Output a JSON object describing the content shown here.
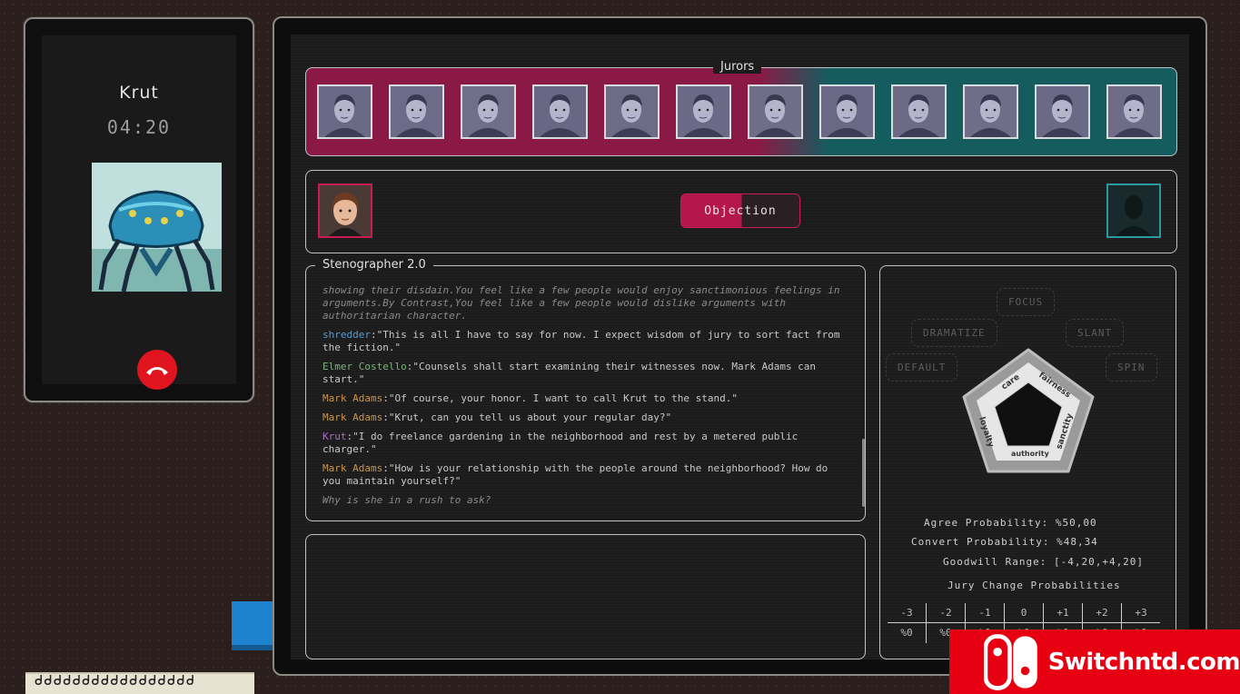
{
  "phone": {
    "caller_name": "Krut",
    "timer": "04:20",
    "hangup_icon": "phone-hangup-icon"
  },
  "jurors": {
    "label": "Jurors",
    "count": 12
  },
  "objection": {
    "label": "Objection",
    "progress": 0.51
  },
  "stenographer": {
    "title": "Stenographer 2.0",
    "lines": [
      {
        "speaker": "",
        "text": "showing their disdain.You feel like a few people would enjoy sanctimonious feelings in arguments.By Contrast,You feel like a few people would dislike arguments with authoritarian character.",
        "style": "italic"
      },
      {
        "speaker": "shredder",
        "text": ":\"This is all I have to say for now. I expect wisdom of jury to sort fact from the fiction.\"",
        "style": "blue"
      },
      {
        "speaker": "Elmer Costello",
        "text": ":\"Counsels shall start examining their witnesses now. Mark Adams can start.\"",
        "style": "green"
      },
      {
        "speaker": "Mark Adams",
        "text": ":\"Of course, your honor. I want to call Krut to the stand.\"",
        "style": "orange"
      },
      {
        "speaker": "Mark Adams",
        "text": ":\"Krut, can you tell us about your regular day?\"",
        "style": "orange"
      },
      {
        "speaker": "Krut",
        "text": ":\"I do freelance gardening in the neighborhood and rest by a metered public charger.\"",
        "style": "purple"
      },
      {
        "speaker": "Mark Adams",
        "text": ":\"How is your relationship with the people around the neighborhood? How do you maintain yourself?\"",
        "style": "orange"
      },
      {
        "speaker": "",
        "text": "Why is she in a rush to ask?",
        "style": "italic"
      }
    ]
  },
  "tactics": {
    "focus": "FOCUS",
    "dramatize": "DRAMATIZE",
    "slant": "SLANT",
    "default": "DEFAULT",
    "spin": "SPIN"
  },
  "moral_wheel": {
    "care": "care",
    "fairness": "fairness",
    "loyalty": "loyalty",
    "sanctity": "sanctity",
    "authority": "authority"
  },
  "stats": {
    "agree": "Agree Probability: %50,00",
    "convert": "Convert Probability: %48,34",
    "goodwill": "Goodwill Range: [-4,20,+4,20]",
    "jury_change_title": "Jury Change Probabilities"
  },
  "jury_change": [
    {
      "delta": "-3",
      "value": "%0"
    },
    {
      "delta": "-2",
      "value": "%0"
    },
    {
      "delta": "-1",
      "value": "%0"
    },
    {
      "delta": "0",
      "value": "%0"
    },
    {
      "delta": "+1",
      "value": "%0"
    },
    {
      "delta": "+2",
      "value": "%0"
    },
    {
      "delta": "+3",
      "value": "%0"
    }
  ],
  "watermark": {
    "text": "Switchntd.com"
  },
  "colors": {
    "prosecution": "#8a1a45",
    "defense": "#155c5f",
    "hangup": "#e0151f"
  }
}
